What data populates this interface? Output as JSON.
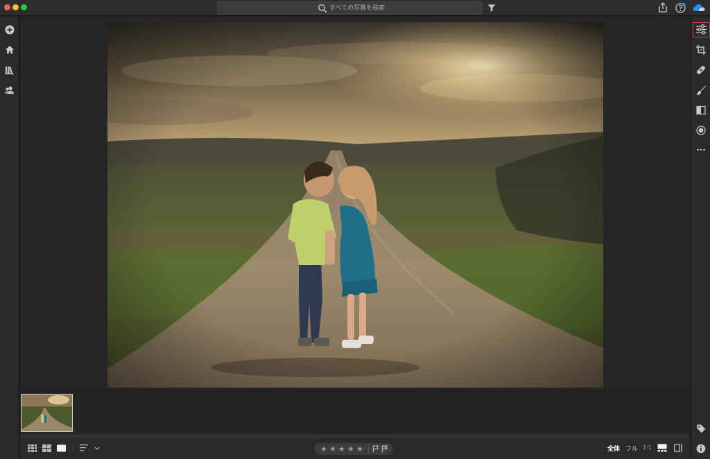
{
  "search": {
    "placeholder": "すべての写真を検索"
  },
  "toolbar": {
    "zoom_fit": "全体",
    "zoom_fill": "フル",
    "zoom_one": "1:1"
  },
  "rating": {
    "stars": [
      "★",
      "★",
      "★",
      "★",
      "★"
    ]
  },
  "icons": {
    "left_rail": [
      "add-photo-icon",
      "home-icon",
      "library-icon",
      "people-icon"
    ],
    "right_rail": [
      "edit-sliders-icon",
      "crop-icon",
      "healing-icon",
      "brush-icon",
      "linear-gradient-icon",
      "radial-gradient-icon",
      "more-icon",
      "keyword-tag-icon",
      "info-icon"
    ],
    "title_right": [
      "share-icon",
      "help-icon",
      "cloud-sync-icon"
    ]
  },
  "colors": {
    "accent_selected": "#e03a3a",
    "panel_bg": "#2a2a2a",
    "canvas_bg": "#252525"
  }
}
